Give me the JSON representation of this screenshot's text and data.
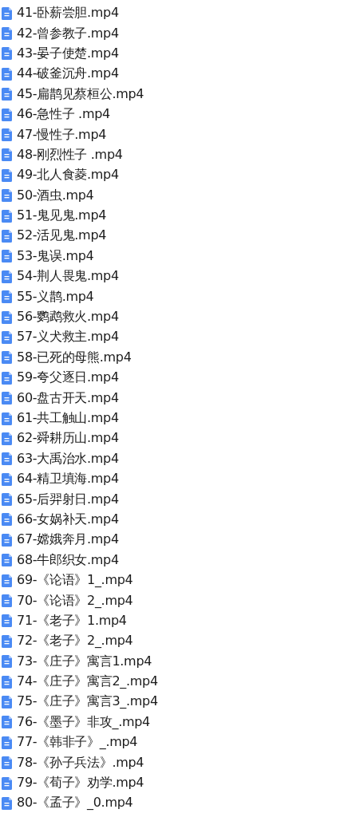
{
  "files": [
    {
      "name": "41-卧薪尝胆.mp4"
    },
    {
      "name": "42-曾参教子.mp4"
    },
    {
      "name": "43-晏子使楚.mp4"
    },
    {
      "name": "44-破釜沉舟.mp4"
    },
    {
      "name": "45-扁鹊见蔡桓公.mp4"
    },
    {
      "name": "46-急性子 .mp4"
    },
    {
      "name": "47-慢性子.mp4"
    },
    {
      "name": "48-刚烈性子 .mp4"
    },
    {
      "name": "49-北人食菱.mp4"
    },
    {
      "name": "50-酒虫.mp4"
    },
    {
      "name": "51-鬼见鬼.mp4"
    },
    {
      "name": "52-活见鬼.mp4"
    },
    {
      "name": "53-鬼误.mp4"
    },
    {
      "name": "54-荆人畏鬼.mp4"
    },
    {
      "name": "55-义鹊.mp4"
    },
    {
      "name": "56-鹦鹉救火.mp4"
    },
    {
      "name": "57-义犬救主.mp4"
    },
    {
      "name": "58-已死的母熊.mp4"
    },
    {
      "name": "59-夸父逐日.mp4"
    },
    {
      "name": "60-盘古开天.mp4"
    },
    {
      "name": "61-共工触山.mp4"
    },
    {
      "name": "62-舜耕历山.mp4"
    },
    {
      "name": "63-大禹治水.mp4"
    },
    {
      "name": "64-精卫填海.mp4"
    },
    {
      "name": "65-后羿射日.mp4"
    },
    {
      "name": "66-女娲补天.mp4"
    },
    {
      "name": "67-嫦娥奔月.mp4"
    },
    {
      "name": "68-牛郎织女.mp4"
    },
    {
      "name": "69-《论语》1_.mp4"
    },
    {
      "name": "70-《论语》2_.mp4"
    },
    {
      "name": "71-《老子》1.mp4"
    },
    {
      "name": "72-《老子》2_.mp4"
    },
    {
      "name": "73-《庄子》寓言1.mp4"
    },
    {
      "name": "74-《庄子》寓言2_.mp4"
    },
    {
      "name": "75-《庄子》寓言3_.mp4"
    },
    {
      "name": "76-《墨子》非攻_.mp4"
    },
    {
      "name": "77-《韩非子》_.mp4"
    },
    {
      "name": "78-《孙子兵法》.mp4"
    },
    {
      "name": "79-《荀子》劝学.mp4"
    },
    {
      "name": "80-《孟子》_0.mp4"
    }
  ]
}
